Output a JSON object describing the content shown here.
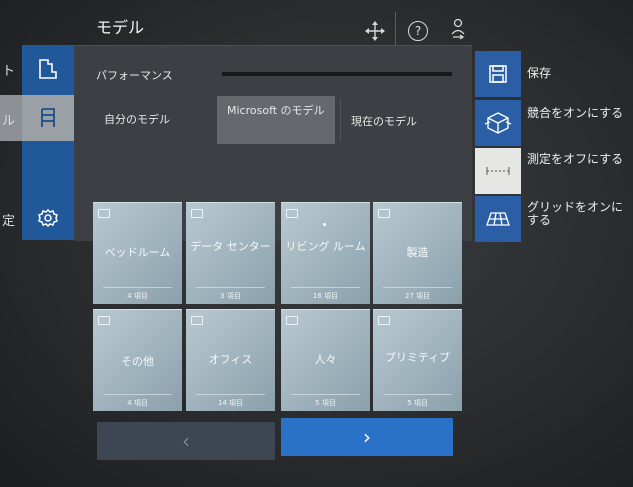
{
  "header": {
    "title": "モデル",
    "help_glyph": "?",
    "icons": [
      "move-icon",
      "help-icon",
      "person-switch-icon"
    ]
  },
  "left_menu": {
    "items": [
      {
        "label": "ト",
        "icon": "puzzle-icon"
      },
      {
        "label": "ル",
        "icon": "bookmark-icon"
      },
      {
        "label": "定",
        "icon": "gear-icon"
      }
    ]
  },
  "panel": {
    "performance_label": "パフォーマンス",
    "tabs": [
      {
        "label": "自分のモデル"
      },
      {
        "label": "Microsoft のモデル",
        "selected": true
      },
      {
        "label": "現在のモデル"
      }
    ]
  },
  "categories": [
    {
      "name": "ベッドルーム",
      "count": "4 項目"
    },
    {
      "name": "データ センター",
      "count": "3 項目"
    },
    {
      "name": "リビング ルーム",
      "count": "16 項目"
    },
    {
      "name": "製造",
      "count": "27 項目"
    },
    {
      "name": "その他",
      "count": "4 項目"
    },
    {
      "name": "オフィス",
      "count": "14 項目"
    },
    {
      "name": "人々",
      "count": "5 項目"
    },
    {
      "name": "プリミティブ",
      "count": "5 項目"
    }
  ],
  "pager": {
    "prev": "‹",
    "next": "›"
  },
  "actions": [
    {
      "label": "保存",
      "icon": "save-icon"
    },
    {
      "label": "競合をオンにする",
      "icon": "collision-cube-icon"
    },
    {
      "label": "測定をオフにする",
      "icon": "measure-icon"
    },
    {
      "label": "グリッドをオンにする",
      "icon": "grid-icon"
    }
  ],
  "colors": {
    "accent": "#2a72c8",
    "rail": "#20589a",
    "panel": "#3c4045",
    "tile": "#a8bcc6"
  }
}
